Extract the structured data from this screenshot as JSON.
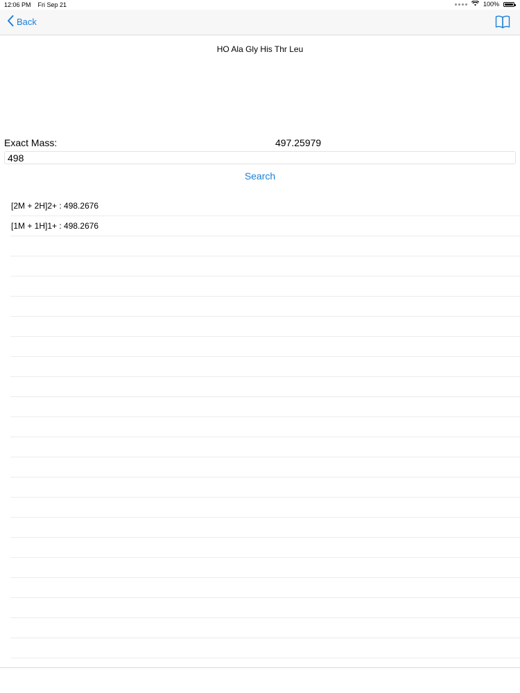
{
  "status_bar": {
    "time": "12:06 PM",
    "date": "Fri Sep 21",
    "battery": "100%",
    "battery_level": 1.0
  },
  "nav": {
    "back_label": "Back",
    "back_icon": "chevron-left-icon",
    "right_icon": "book-icon",
    "accent_color": "#1a7fd8"
  },
  "sequence": "HO Ala Gly His Thr Leu",
  "mass": {
    "label": "Exact Mass:",
    "value": "497.25979"
  },
  "search": {
    "value": "498",
    "button_label": "Search"
  },
  "results": [
    "[2M + 2H]2+ : 498.2676",
    "[1M + 1H]1+ : 498.2676"
  ]
}
